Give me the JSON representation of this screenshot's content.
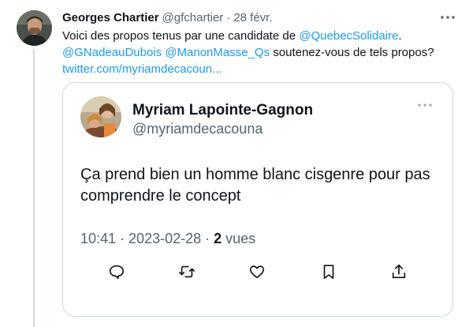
{
  "tweet": {
    "author_name": "Georges Chartier",
    "author_handle": "@gfchartier",
    "dot": "·",
    "date": "28 févr.",
    "text_part1": "Voici des propos tenus par une candidate de ",
    "mention_party": "@QuebecSolidaire",
    "text_part2": ".",
    "mention_1": "@GNadeauDubois",
    "mention_2": "@ManonMasse_Qs",
    "text_part3": " soutenez-vous de tels propos?",
    "link_text": "twitter.com/myriamdecacoun..."
  },
  "quote": {
    "author_name": "Myriam Lapointe-Gagnon",
    "author_handle": "@myriamdecacouna",
    "text": "Ça prend bien un homme blanc cisgenre pour pas comprendre le concept",
    "time": "10:41",
    "sep1": "·",
    "date": "2023-02-28",
    "sep2": "·",
    "views_count": "2",
    "views_label": "vues"
  },
  "icons": {
    "more": "more-horizontal-icon",
    "reply": "reply-bubble-icon",
    "retweet": "retweet-arrows-icon",
    "like": "heart-icon",
    "bookmark": "bookmark-icon",
    "share": "share-upload-icon"
  },
  "colors": {
    "link": "#1d9bf0",
    "text_primary": "#0f1419",
    "text_secondary": "#536471",
    "border": "#cfd9de"
  }
}
